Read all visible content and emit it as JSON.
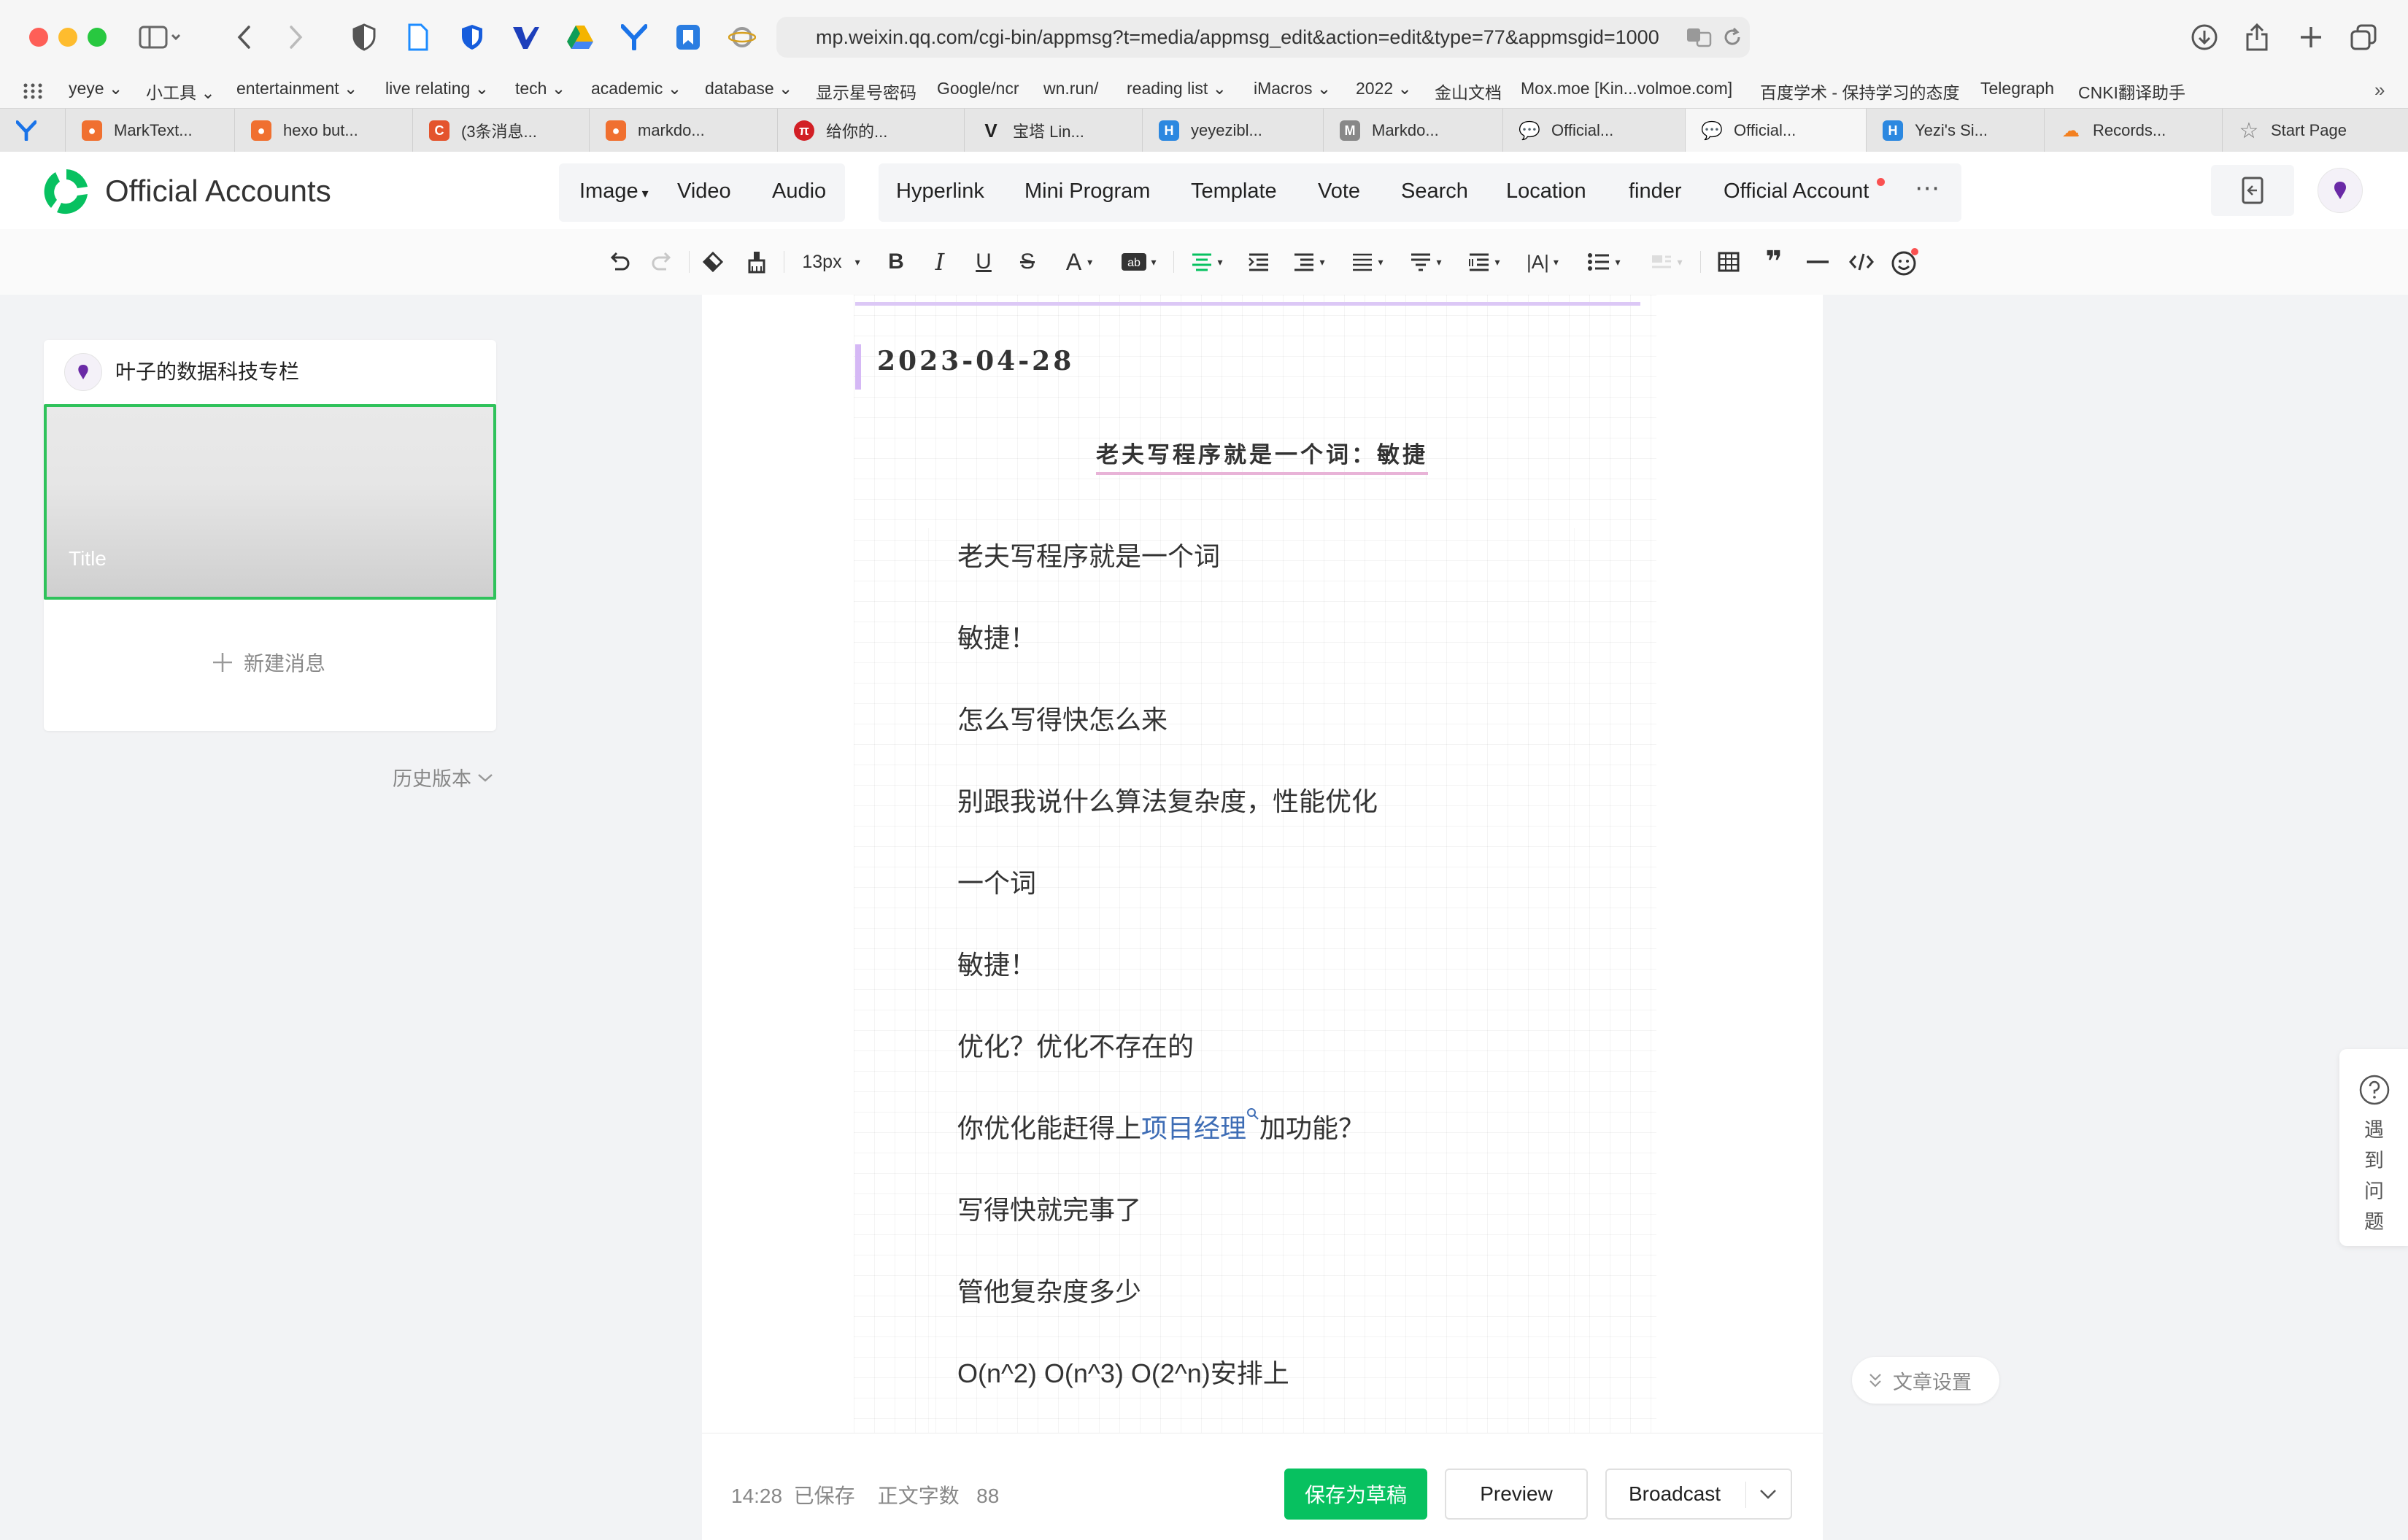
{
  "browser": {
    "url": "mp.weixin.qq.com/cgi-bin/appmsg?t=media/appmsg_edit&action=edit&type=77&appmsgid=1000",
    "bookmarks": [
      "yeye",
      "小工具",
      "entertainment",
      "live relating",
      "tech",
      "academic",
      "database",
      "显示星号密码",
      "Google/ncr",
      "wn.run/",
      "reading list",
      "iMacros",
      "2022",
      "金山文档",
      "Mox.moe [Kin...volmoe.com]",
      "百度学术 - 保持学习的态度",
      "Telegraph",
      "CNKI翻译助手"
    ],
    "tabs": [
      {
        "label": "MarkText...",
        "color": "#f07030"
      },
      {
        "label": "hexo but...",
        "color": "#f07030"
      },
      {
        "label": "(3条消息...",
        "color": "#e4542d"
      },
      {
        "label": "markdo...",
        "color": "#f07030"
      },
      {
        "label": "给你的...",
        "color": "#d21f25"
      },
      {
        "label": "宝塔 Lin...",
        "color": "#222222"
      },
      {
        "label": "yeyezibl...",
        "color": "#2c88e0"
      },
      {
        "label": "Markdo...",
        "color": "#888888"
      },
      {
        "label": "Official...",
        "color": "#666666"
      },
      {
        "label": "Official...",
        "color": "#666666"
      },
      {
        "label": "Yezi's Si...",
        "color": "#2c88e0"
      },
      {
        "label": "Records...",
        "color": "#f38020"
      },
      {
        "label": "Start Page",
        "color": "#888888"
      }
    ]
  },
  "header": {
    "brand": "Official Accounts",
    "insert_media": [
      "Image",
      "Video",
      "Audio"
    ],
    "insert_other": [
      "Hyperlink",
      "Mini Program",
      "Template",
      "Vote",
      "Search",
      "Location",
      "finder",
      "Official Account"
    ]
  },
  "toolbar": {
    "font_size": "13px"
  },
  "left_panel": {
    "account_name": "叶子的数据科技专栏",
    "thumb_title": "Title",
    "new_message": "新建消息",
    "history": "历史版本"
  },
  "editor": {
    "date": "2023-04-28",
    "heading": "老夫写程序就是一个词：敏捷",
    "lines": [
      "老夫写程序就是一个词",
      "敏捷！",
      "怎么写得快怎么来",
      "别跟我说什么算法复杂度，性能优化",
      "一个词",
      "敏捷！",
      "优化？优化不存在的",
      "写得快就完事了",
      "管他复杂度多少",
      "O(n^2) O(n^3) O(2^n)安排上"
    ],
    "link_line": {
      "before": "你优化能赶得上",
      "link": "项目经理",
      "after": "加功能？"
    }
  },
  "footer": {
    "status_time": "14:28",
    "status_saved": "已保存",
    "word_count_label": "正文字数",
    "word_count": "88",
    "save_draft": "保存为草稿",
    "preview": "Preview",
    "broadcast": "Broadcast"
  },
  "side": {
    "help": "遇到问题",
    "article_settings": "文章设置"
  },
  "colors": {
    "wechat_green": "#07c160",
    "selection_green": "#2fc25b",
    "link_blue": "#3e6db5"
  }
}
